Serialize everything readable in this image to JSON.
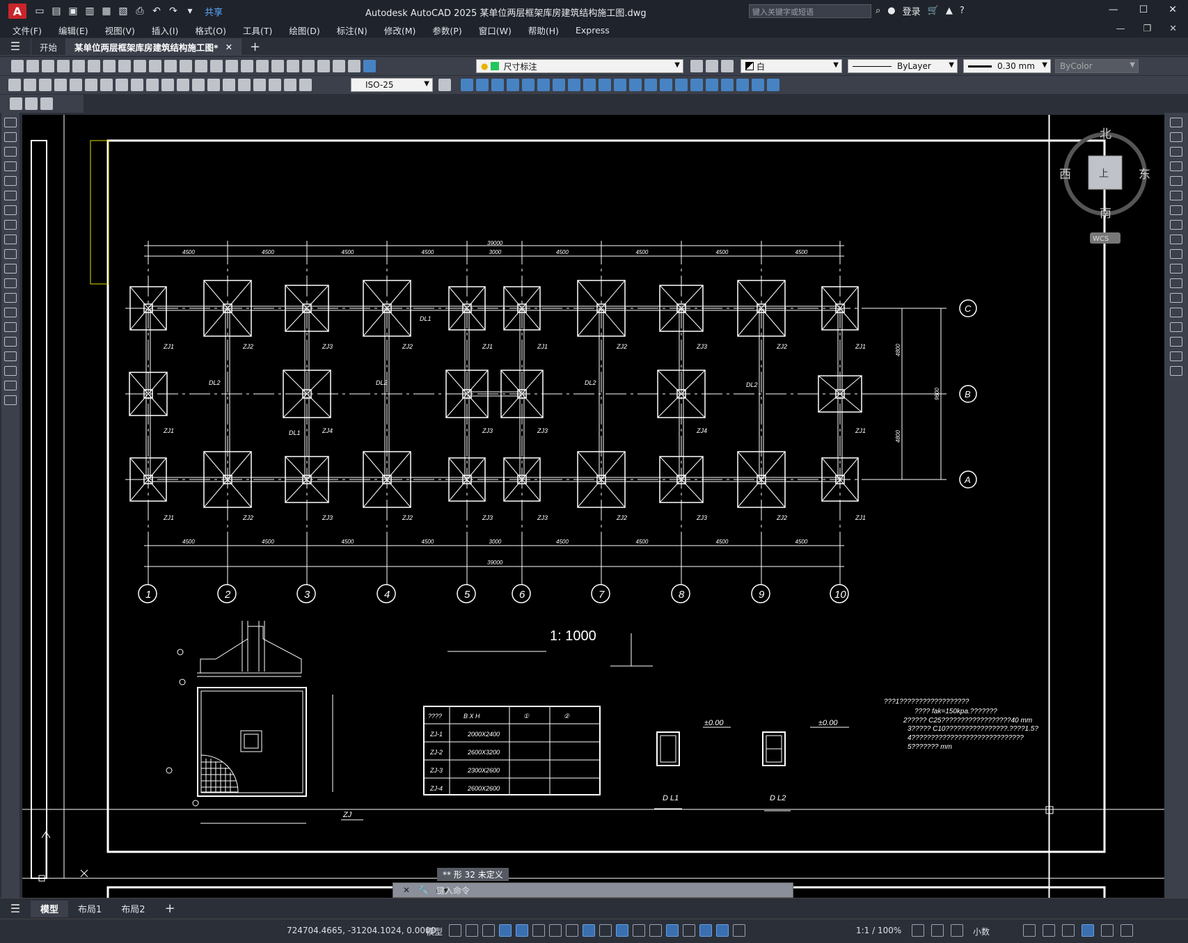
{
  "app": {
    "logo": "A",
    "title": "Autodesk AutoCAD 2025    某单位两层框架库房建筑结构施工图.dwg",
    "share_label": "共享",
    "search_placeholder": "键入关键字或短语",
    "login_label": "登录"
  },
  "menu": [
    "文件(F)",
    "编辑(E)",
    "视图(V)",
    "插入(I)",
    "格式(O)",
    "工具(T)",
    "绘图(D)",
    "标注(N)",
    "修改(M)",
    "参数(P)",
    "窗口(W)",
    "帮助(H)",
    "Express"
  ],
  "tabs": [
    {
      "label": "开始"
    },
    {
      "label": "某单位两层框架库房建筑结构施工图*"
    }
  ],
  "toolbar": {
    "layer_value": "尺寸标注",
    "color_value": "白",
    "linetype_value": "ByLayer",
    "lineweight_value": "0.30 mm",
    "plotstyle_value": "ByColor",
    "dimstyle_value": "ISO-25"
  },
  "viewcube": {
    "north": "北",
    "south": "南",
    "east": "东",
    "west": "西",
    "top": "上",
    "wcs": "WCS"
  },
  "drawing": {
    "scale_label": "1: 1000",
    "dims_top": [
      "4500",
      "4500",
      "4500",
      "4500",
      "3000",
      "4500",
      "4500",
      "4500",
      "4500"
    ],
    "dims_bottom": [
      "4500",
      "4500",
      "4500",
      "4500",
      "3000",
      "4500",
      "4500",
      "4500",
      "4500"
    ],
    "total_dim": "39000",
    "side_dims": [
      "4800",
      "4800"
    ],
    "side_total": "9600",
    "axis_numbers": [
      "1",
      "2",
      "3",
      "4",
      "5",
      "6",
      "7",
      "8",
      "9",
      "10"
    ],
    "axis_letters": [
      "C",
      "B",
      "A"
    ],
    "footing_labels": {
      "top": [
        "ZJ1",
        "ZJ2",
        "ZJ3",
        "ZJ2",
        "ZJ1",
        "ZJ1",
        "ZJ2",
        "ZJ3",
        "ZJ2",
        "ZJ1"
      ],
      "mid": [
        "ZJ1",
        "ZJ4",
        "ZJ3",
        "ZJ3",
        "ZJ4",
        "ZJ1"
      ],
      "bot": [
        "ZJ1",
        "ZJ2",
        "ZJ3",
        "ZJ2",
        "ZJ3",
        "ZJ3",
        "ZJ2",
        "ZJ3",
        "ZJ2",
        "ZJ1"
      ]
    },
    "beam_labels": [
      "DL1",
      "DL2",
      "DL2",
      "DL2",
      "DL2",
      "DL1"
    ],
    "table": {
      "headers": [
        "????",
        "B X H",
        "①",
        "②"
      ],
      "rows": [
        [
          "ZJ-1",
          "2000X2400"
        ],
        [
          "ZJ-2",
          "2600X3200"
        ],
        [
          "ZJ-3",
          "2300X2600"
        ],
        [
          "ZJ-4",
          "2600X2600"
        ]
      ]
    },
    "sections": [
      {
        "label": "D L1",
        "elev": "±0.00"
      },
      {
        "label": "D L2",
        "elev": "±0.00"
      }
    ],
    "notes": [
      "???1??????????????????",
      "???? fak=150kpa.???????",
      "2????? C25??????????????????40 mm",
      "3????? C10????????????????.????1.5?",
      "4?????????????????????????????",
      "5??????? mm"
    ],
    "detail_label": "ZJ"
  },
  "cmd": {
    "message": "** 形 32 未定义",
    "placeholder": "键入命令"
  },
  "layout_tabs": [
    "模型",
    "布局1",
    "布局2"
  ],
  "status": {
    "coords": "724704.4665, -31204.1024, 0.0000",
    "model": "模型",
    "scale": "1:1 / 100%",
    "units": "小数"
  }
}
